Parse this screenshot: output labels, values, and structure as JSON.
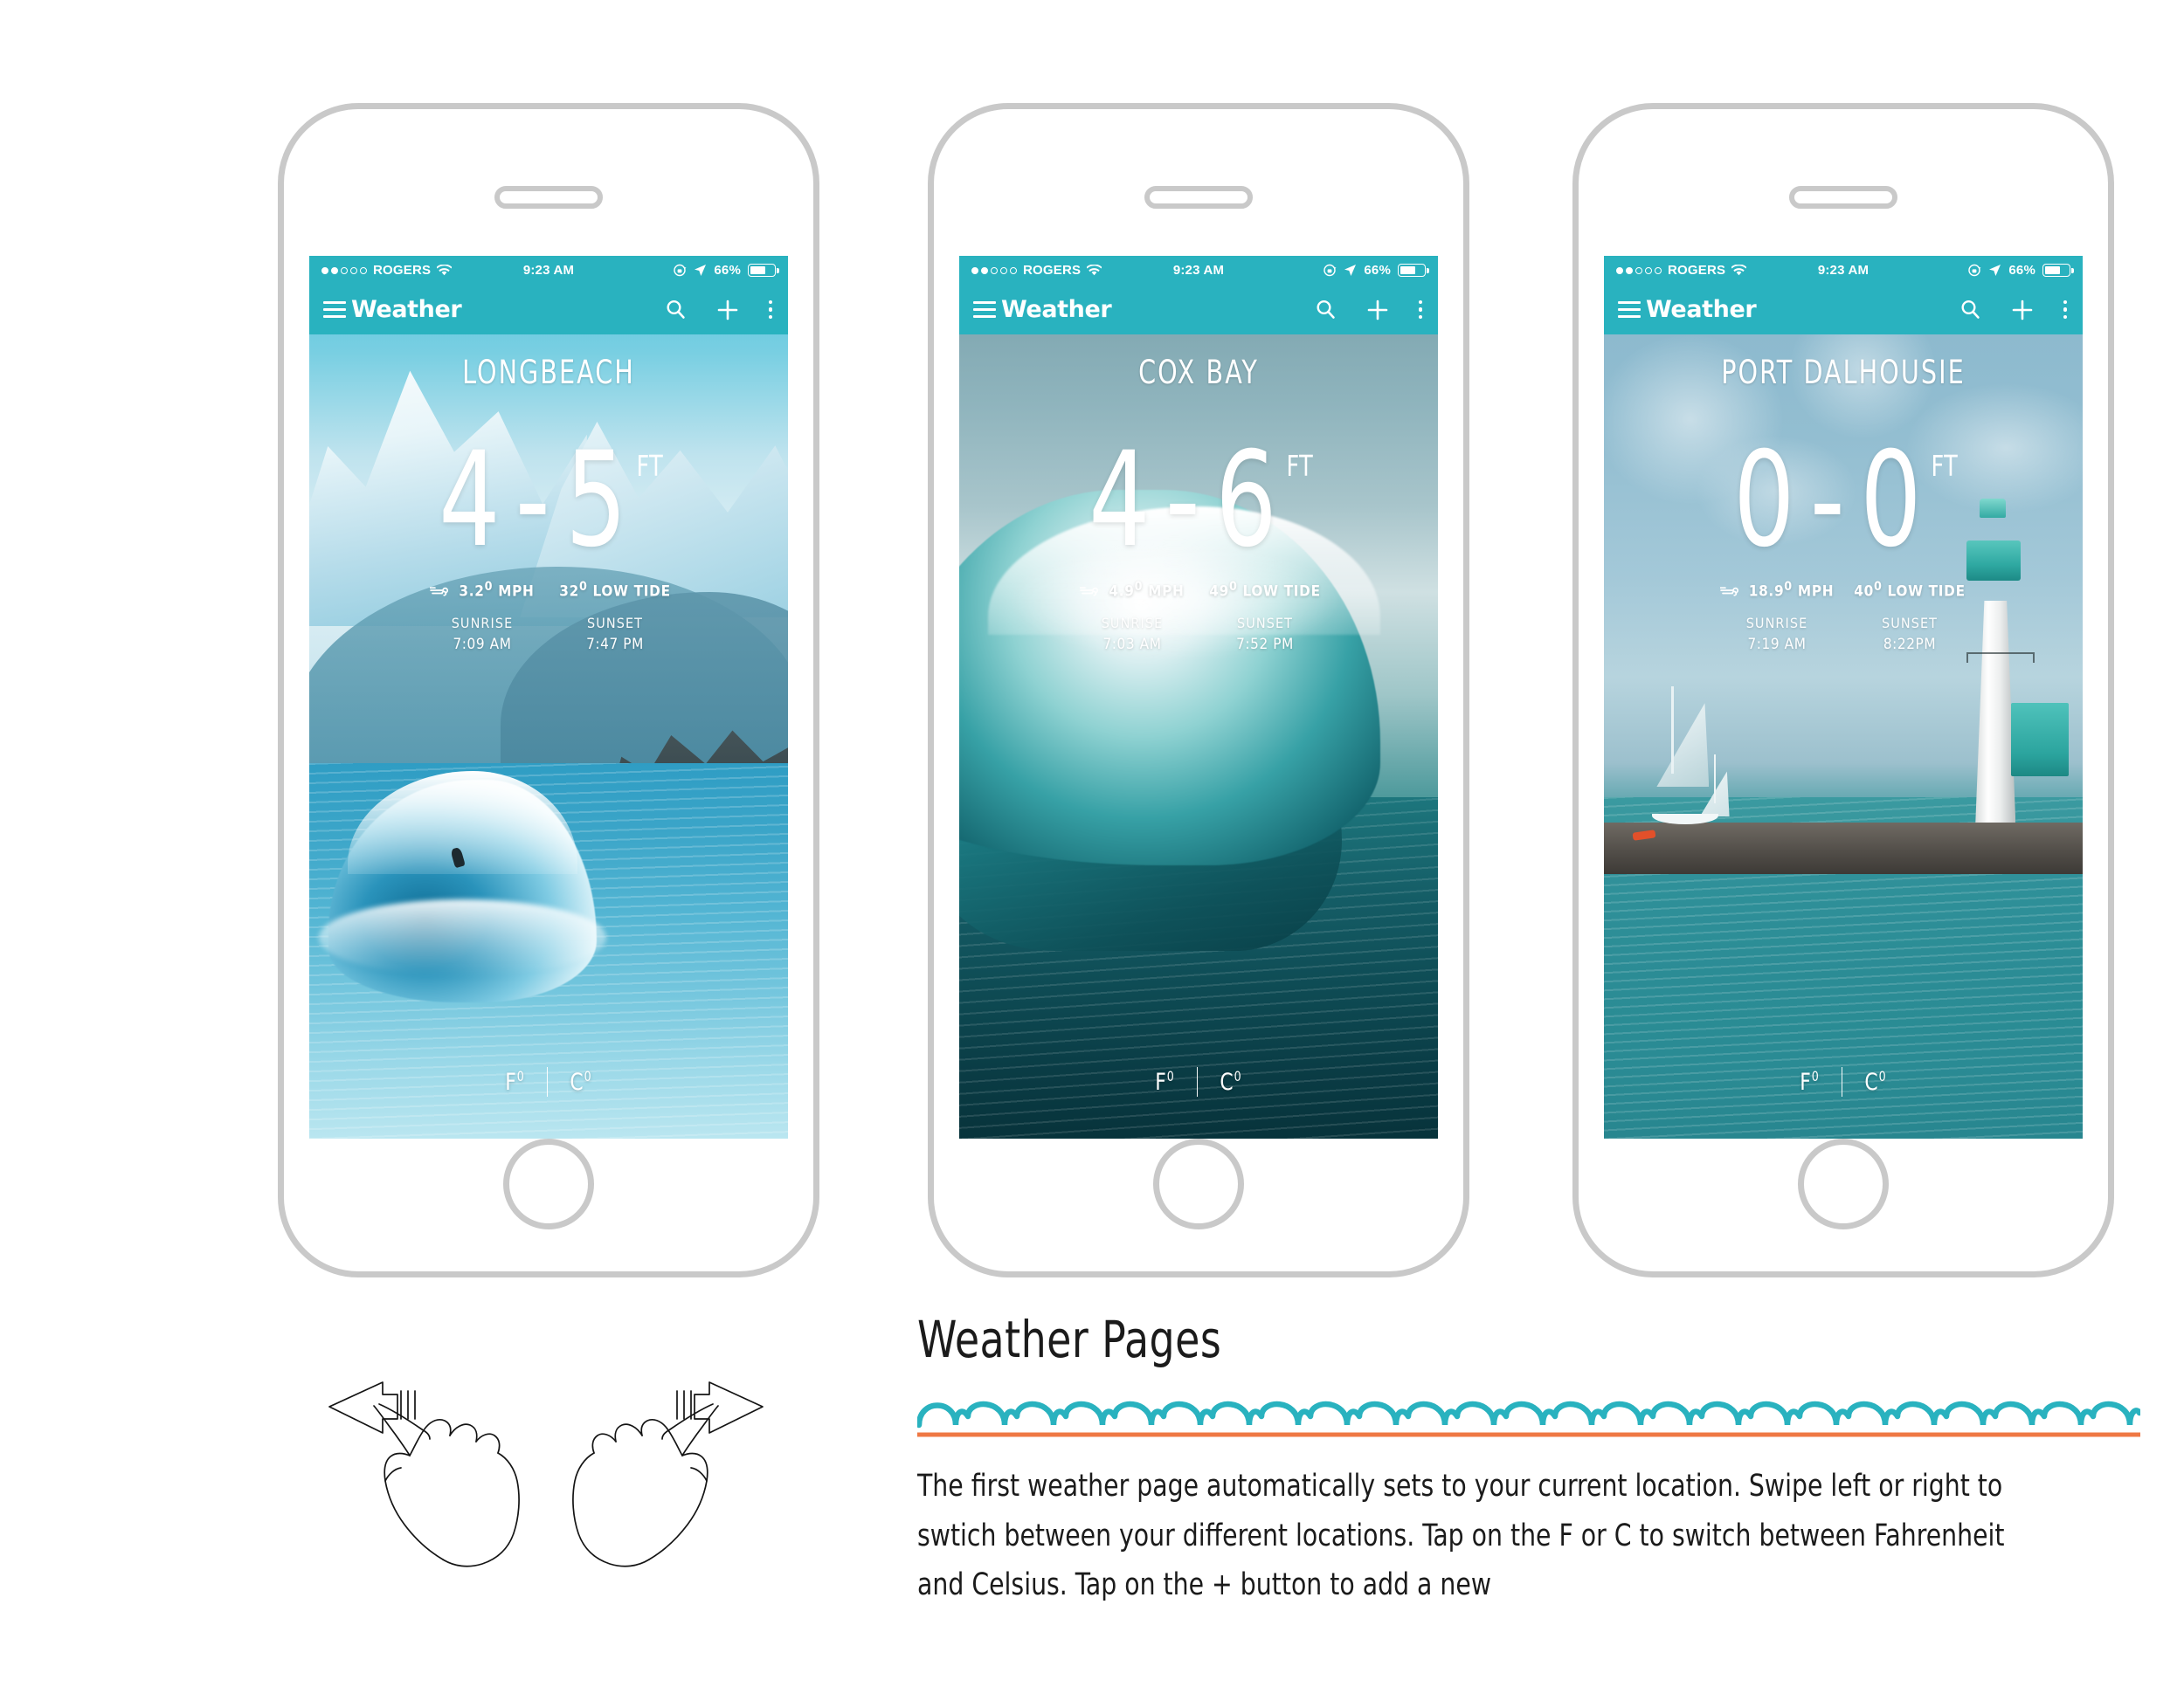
{
  "theme": {
    "teal": "#29b2bf",
    "wave_rule_color": "#29b2bf",
    "underline_color": "#ef7844",
    "frame_color": "#c9c9c9",
    "text_color": "#1b1b1b"
  },
  "status_bar": {
    "carrier": "ROGERS",
    "signal_dots_filled": 2,
    "signal_dots_total": 5,
    "wifi_icon": "wifi-icon",
    "time": "9:23 AM",
    "lock_icon": "rotation-lock-icon",
    "location_icon": "location-arrow-icon",
    "battery_percent": "66%",
    "battery_level": 66
  },
  "app_bar": {
    "menu_icon": "hamburger-menu-icon",
    "title": "Weather",
    "search_icon": "search-icon",
    "add_icon": "plus-icon",
    "overflow_icon": "kebab-menu-icon"
  },
  "unit_toggle": {
    "fahrenheit": "F",
    "celsius": "C",
    "degree": "0"
  },
  "labels": {
    "mph": "MPH",
    "low_tide": "LOW TIDE",
    "sunrise": "SUNRISE",
    "sunset": "SUNSET",
    "feet": "FT",
    "wind_icon": "wind-icon",
    "range_dash": "-"
  },
  "pages": [
    {
      "id": "longbeach",
      "location": "LONGBEACH",
      "wave_min": "4",
      "wave_max": "5",
      "wave_unit": "FT",
      "wind_speed": "3.2",
      "wind_degree": "0",
      "wind_unit": "MPH",
      "tide_value": "32",
      "tide_degree": "0",
      "tide_label": "LOW TIDE",
      "sunrise_label": "SUNRISE",
      "sunrise_time": "7:09 AM",
      "sunset_label": "SUNSET",
      "sunset_time": "7:47 PM",
      "scene": "snow-mountains-barrel-wave"
    },
    {
      "id": "coxbay",
      "location": "COX BAY",
      "wave_min": "4",
      "wave_max": "6",
      "wave_unit": "FT",
      "wind_speed": "4.9",
      "wind_degree": "0",
      "wind_unit": "MPH",
      "tide_value": "49",
      "tide_degree": "0",
      "tide_label": "LOW TIDE",
      "sunrise_label": "SUNRISE",
      "sunrise_time": "7:03 AM",
      "sunset_label": "SUNSET",
      "sunset_time": "7:52 PM",
      "scene": "breaking-teal-wave"
    },
    {
      "id": "portdalhousie",
      "location": "PORT DALHOUSIE",
      "wave_min": "0",
      "wave_max": "0",
      "wave_unit": "FT",
      "wind_speed": "18.9",
      "wind_degree": "0",
      "wind_unit": "MPH",
      "tide_value": "40",
      "tide_degree": "0",
      "tide_label": "LOW TIDE",
      "sunrise_label": "SUNRISE",
      "sunrise_time": "7:19 AM",
      "sunset_label": "SUNSET",
      "sunset_time": "8:22PM",
      "scene": "lighthouse-pier-sailboats"
    }
  ],
  "gestures": [
    {
      "id": "swipe-left",
      "icon": "hand-swipe-left-icon"
    },
    {
      "id": "swipe-right",
      "icon": "hand-swipe-right-icon"
    }
  ],
  "description": {
    "title": "Weather Pages",
    "body": "The first weather page automatically sets to your current location. Swipe left or right to swtich between your different locations. Tap on the F or C to switch between Fahrenheit and Celsius. Tap on the + button to add a new"
  }
}
